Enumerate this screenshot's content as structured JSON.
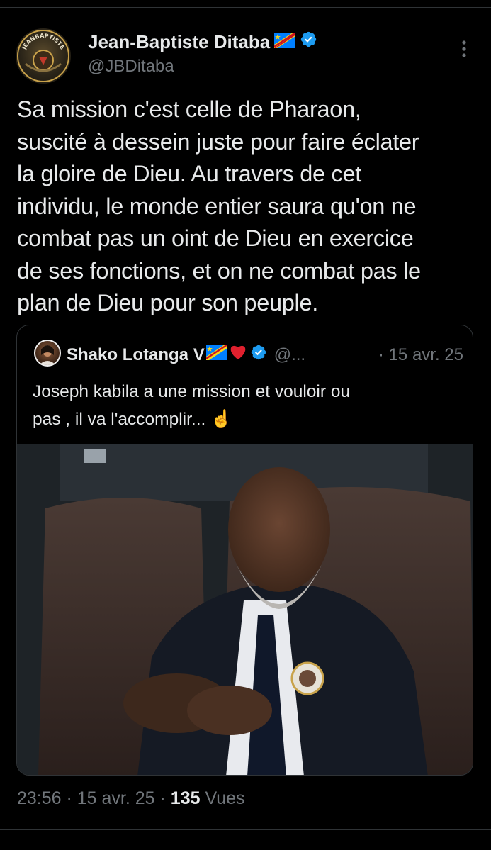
{
  "tweet": {
    "author": {
      "name": "Jean-Baptiste Ditaba",
      "handle": "@JBDitaba",
      "avatar_text": "JEANBAPTISTE",
      "flag_icon": "drc-flag-icon",
      "verified_icon": "verified-badge-icon"
    },
    "text": "Sa mission c'est celle de Pharaon,\nsuscité à dessein juste pour faire éclater\nla gloire de Dieu. Au travers de cet\nindividu, le monde entier saura qu'on ne\ncombat pas un oint de Dieu en exercice\nde ses fonctions, et on ne combat pas le\nplan de Dieu pour son peuple.",
    "quote": {
      "name": "Shako Lotanga V",
      "handle": "@...",
      "date": "· 15 avr. 25",
      "text": "Joseph kabila a une mission et vouloir ou\npas , il va l'accomplir...",
      "emoji": "☝️"
    },
    "footer": {
      "time": "23:56 · 15 avr. 25 · ",
      "views_count": "135",
      "views_label": " Vues"
    }
  },
  "colors": {
    "background": "#000000",
    "text": "#e7e9ea",
    "muted": "#71767b",
    "verified": "#1d9bf0",
    "border": "#2f3336"
  }
}
